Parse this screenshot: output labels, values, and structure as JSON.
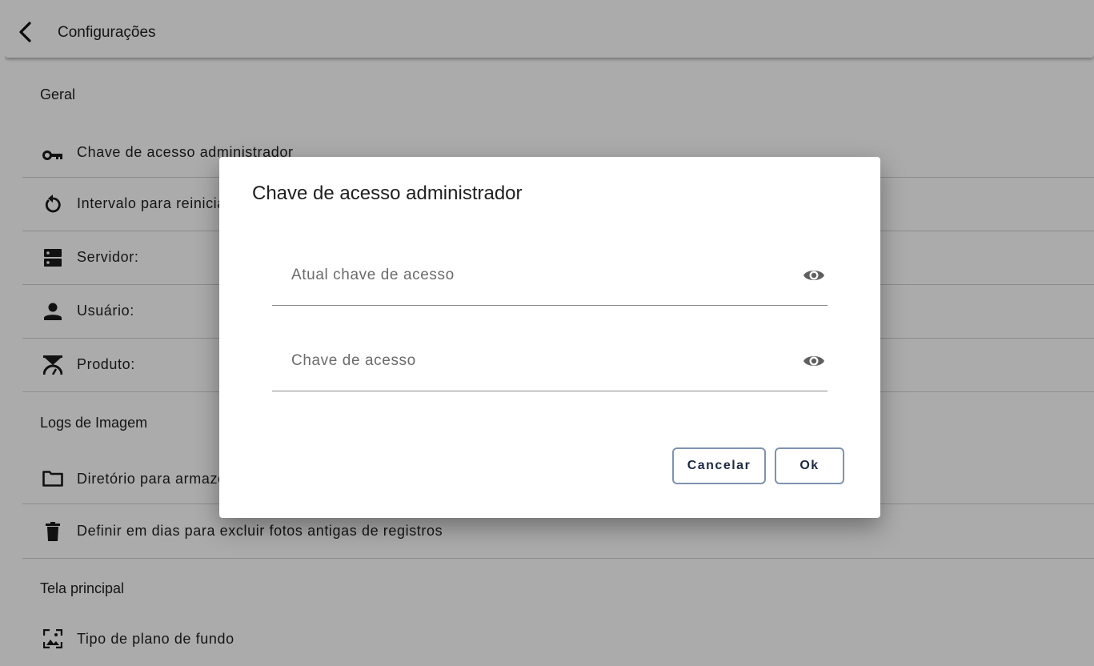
{
  "appbar": {
    "title": "Configurações"
  },
  "sections": {
    "geral": "Geral",
    "logs": "Logs de Imagem",
    "tela": "Tela principal"
  },
  "items": {
    "chave": "Chave de acesso administrador",
    "intervalo": "Intervalo para reiniciar",
    "servidor": "Servidor:",
    "usuario": "Usuário:",
    "produto": "Produto:",
    "diretorio": "Diretório para armazenar",
    "excluir": "Definir em dias para excluir fotos antigas de registros",
    "plano": "Tipo de plano de fundo"
  },
  "dialog": {
    "title": "Chave de acesso administrador",
    "current_placeholder": "Atual chave de acesso",
    "new_placeholder": "Chave de acesso",
    "cancel_label": "Cancelar",
    "ok_label": "Ok"
  },
  "icons": {
    "back": "chevron-left-icon",
    "key": "key-icon",
    "restart": "restart-icon",
    "server": "server-icon",
    "user": "person-icon",
    "product": "scale-icon",
    "folder": "folder-icon",
    "delete": "trash-icon",
    "wallpaper": "wallpaper-icon",
    "visibility": "eye-icon"
  },
  "colors": {
    "button_border": "#7e93b2",
    "button_text": "#1c2a44",
    "scrim": "rgba(0,0,0,0.33)"
  }
}
